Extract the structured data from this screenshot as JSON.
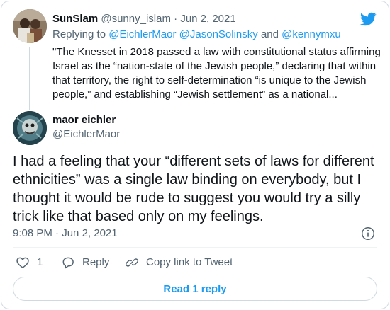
{
  "parent_tweet": {
    "author_name": "SunSlam",
    "author_handle": "@sunny_islam",
    "separator": "·",
    "date": "Jun 2, 2021",
    "replying_prefix": "Replying to",
    "replying_mentions": [
      "@EichlerMaor",
      "@JasonSolinsky",
      "@kennymxu"
    ],
    "replying_and": "and",
    "text": "\"The Knesset in 2018 passed a law with constitutional status affirming Israel as the “nation-state of the Jewish people,” declaring that within that territory, the right to self-determination “is unique to the Jewish people,” and establishing “Jewish settlement” as a national..."
  },
  "main_tweet": {
    "author_name": "maor eichler",
    "author_handle": "@EichlerMaor",
    "text": "I had a feeling that your “different sets of laws for different ethnicities” was a single law binding on everybody, but I thought it would be rude to suggest you would try a silly trick like that based only on my feelings.",
    "time": "9:08 PM",
    "separator": "·",
    "date": "Jun 2, 2021"
  },
  "actions": {
    "like_count": "1",
    "reply_label": "Reply",
    "copy_link_label": "Copy link to Tweet"
  },
  "read_replies_label": "Read 1 reply",
  "icons": {
    "brand": "twitter-bird-icon",
    "info": "info-icon",
    "like": "heart-icon",
    "reply": "speech-bubble-icon",
    "link": "link-icon"
  },
  "colors": {
    "accent": "#1d9bf0",
    "secondary_text": "#536471",
    "primary_text": "#0f1419",
    "border": "#cfd9de"
  }
}
